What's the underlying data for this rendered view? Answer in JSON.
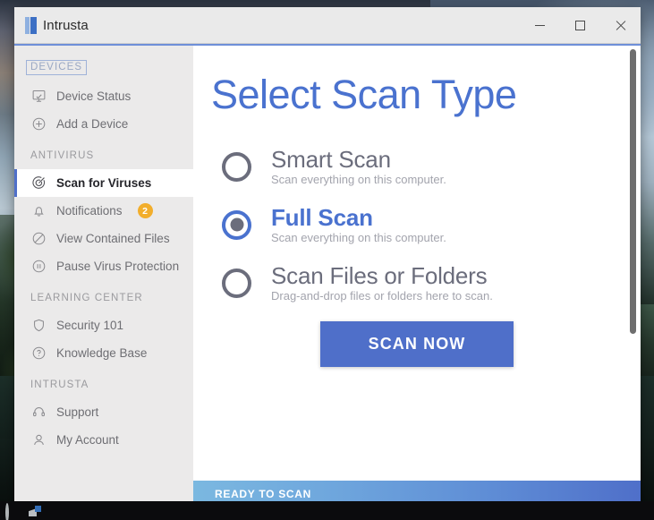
{
  "window": {
    "app_title": "Intrusta",
    "logo_icon": "intrusta-logo-icon",
    "minimize_label": "Minimize",
    "maximize_label": "Maximize",
    "close_label": "Close"
  },
  "sidebar": {
    "sections": [
      {
        "label": "DEVICES",
        "focused": true,
        "items": [
          {
            "label": "Device Status",
            "icon": "monitor-check-icon",
            "active": false,
            "badge": null
          },
          {
            "label": "Add a Device",
            "icon": "plus-circle-icon",
            "active": false,
            "badge": null
          }
        ]
      },
      {
        "label": "ANTIVIRUS",
        "focused": false,
        "items": [
          {
            "label": "Scan for Viruses",
            "icon": "scan-target-icon",
            "active": true,
            "badge": null
          },
          {
            "label": "Notifications",
            "icon": "bell-icon",
            "active": false,
            "badge": "2"
          },
          {
            "label": "View Contained Files",
            "icon": "block-circle-icon",
            "active": false,
            "badge": null
          },
          {
            "label": "Pause Virus Protection",
            "icon": "pause-circle-icon",
            "active": false,
            "badge": null
          }
        ]
      },
      {
        "label": "LEARNING CENTER",
        "focused": false,
        "items": [
          {
            "label": "Security 101",
            "icon": "shield-icon",
            "active": false,
            "badge": null
          },
          {
            "label": "Knowledge Base",
            "icon": "question-circle-icon",
            "active": false,
            "badge": null
          }
        ]
      },
      {
        "label": "INTRUSTA",
        "focused": false,
        "items": [
          {
            "label": "Support",
            "icon": "headset-icon",
            "active": false,
            "badge": null
          },
          {
            "label": "My Account",
            "icon": "user-icon",
            "active": false,
            "badge": null
          }
        ]
      }
    ]
  },
  "main": {
    "page_title": "Select Scan Type",
    "scan_options": [
      {
        "title": "Smart Scan",
        "subtitle": "Scan everything on this computer.",
        "selected": false
      },
      {
        "title": "Full Scan",
        "subtitle": "Scan everything on this computer.",
        "selected": true
      },
      {
        "title": "Scan Files or Folders",
        "subtitle": "Drag-and-drop files or folders here to scan.",
        "selected": false
      }
    ],
    "scan_button_label": "SCAN NOW"
  },
  "statusbar": {
    "text": "READY TO SCAN"
  },
  "taskbar": {
    "items": [
      {
        "icon": "cortana-icon"
      },
      {
        "icon": "microsoft-store-icon"
      }
    ]
  },
  "colors": {
    "accent_blue": "#4f6fc9",
    "title_blue": "#4a72cf",
    "badge_orange": "#f2ae2c",
    "muted_gray": "#6b6d7c",
    "sidebar_bg": "#ebeaea"
  }
}
